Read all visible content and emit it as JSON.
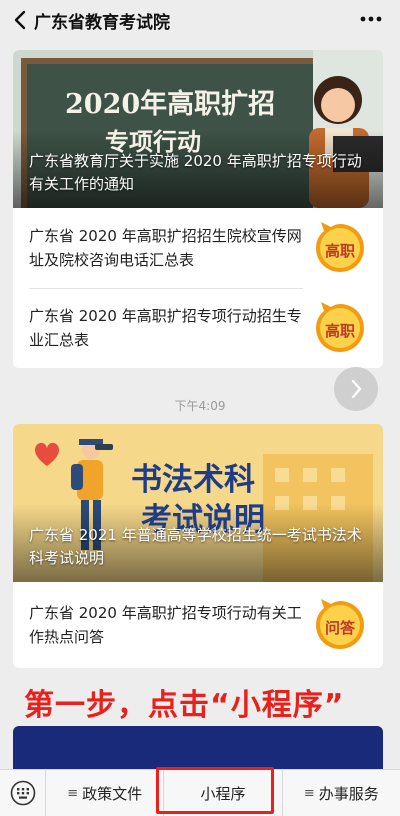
{
  "header": {
    "title": "广东省教育考试院"
  },
  "card1": {
    "banner": {
      "heading_line1": "2020年高职扩招",
      "heading_line2": "专项行动",
      "caption": "广东省教育厅关于实施 2020 年高职扩招专项行动有关工作的通知"
    },
    "items": [
      {
        "title": "广东省 2020 年高职扩招招生院校宣传网址及院校咨询电话汇总表",
        "badge": "高职"
      },
      {
        "title": "广东省 2020 年高职扩招专项行动招生专业汇总表",
        "badge": "高职"
      }
    ]
  },
  "timestamp": "下午4:09",
  "card2": {
    "banner": {
      "heading_line1": "书法术科",
      "heading_line2": "考试说明",
      "caption": "广东省 2021 年普通高等学校招生统一考试书法术科考试说明"
    },
    "items": [
      {
        "title": "广东省 2020 年高职扩招专项行动有关工作热点问答",
        "badge": "问答"
      }
    ]
  },
  "annotation": "第一步，点击“小程序”",
  "bottom_menu": {
    "items": [
      {
        "label": "政策文件",
        "lines": "≡"
      },
      {
        "label": "小程序",
        "lines": ""
      },
      {
        "label": "办事服务",
        "lines": "≡"
      }
    ]
  },
  "colors": {
    "accent_red": "#e8211d",
    "badge_orange": "#f39c12",
    "chalkboard": "#3e5247",
    "banner2_bg": "#f6d88a",
    "dark_card": "#1a2a7a"
  }
}
